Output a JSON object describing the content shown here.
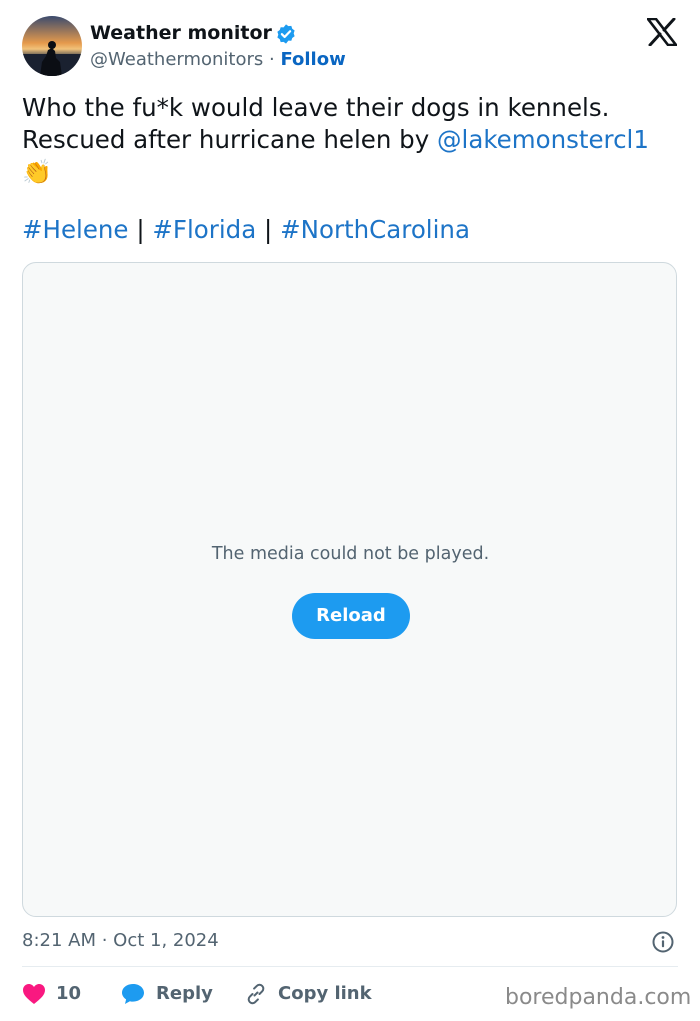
{
  "tweet": {
    "author": {
      "display_name": "Weather monitor",
      "handle": "@Weathermonitors",
      "separator": " · ",
      "follow_label": "Follow",
      "verified_icon": "verified-badge-icon",
      "avatar_icon": "avatar"
    },
    "text": {
      "line1": "Who the fu*k would leave their dogs in kennels.",
      "line2_prefix": "Rescued after hurricane helen by ",
      "mention": "@lakemonstercl1",
      "emoji": "👏"
    },
    "hashtags": [
      "#Helene",
      "#Florida",
      "#NorthCarolina"
    ],
    "hashtag_separator": "|",
    "media": {
      "message": "The media could not be played.",
      "reload_label": "Reload"
    },
    "timestamp": "8:21 AM · Oct 1, 2024",
    "actions": {
      "like_count": "10",
      "reply_label": "Reply",
      "copy_label": "Copy link"
    }
  },
  "watermark": "boredpanda.com",
  "colors": {
    "link": "#1d74c7",
    "follow": "#0a66c2",
    "verified": "#1d9bf0",
    "reload_button": "#1d9bf0",
    "heart": "#f91880",
    "muted_text": "#536471"
  },
  "icons": {
    "logo": "x-logo-icon",
    "info": "info-icon",
    "like": "heart-icon",
    "reply": "speech-bubble-icon",
    "copy": "link-icon"
  }
}
